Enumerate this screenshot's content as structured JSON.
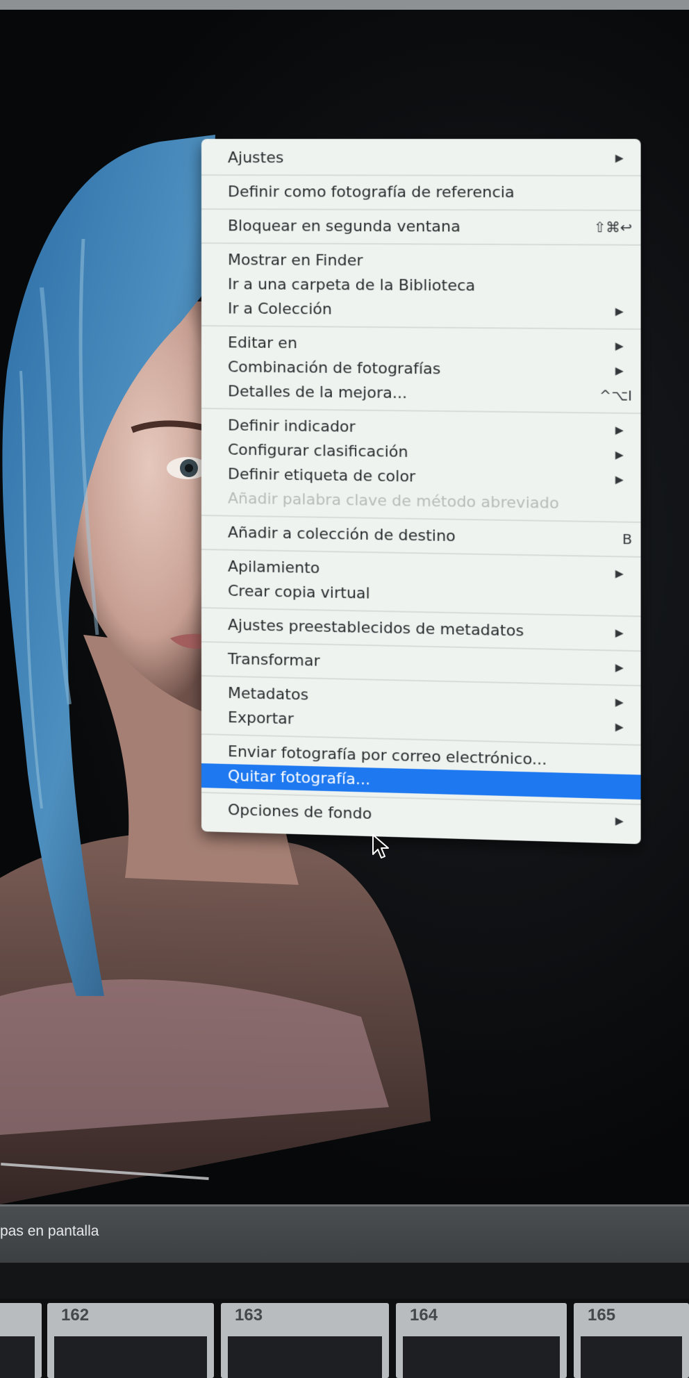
{
  "context_menu": {
    "groups": [
      {
        "items": [
          {
            "label": "Ajustes",
            "arrow": "▶"
          }
        ]
      },
      {
        "items": [
          {
            "label": "Definir como fotografía de referencia"
          }
        ]
      },
      {
        "items": [
          {
            "label": "Bloquear en segunda ventana",
            "shortcut": "⇧⌘↩"
          }
        ]
      },
      {
        "items": [
          {
            "label": "Mostrar en Finder"
          },
          {
            "label": "Ir a una carpeta de la Biblioteca"
          },
          {
            "label": "Ir a Colección",
            "arrow": "▶"
          }
        ]
      },
      {
        "items": [
          {
            "label": "Editar en",
            "arrow": "▶"
          },
          {
            "label": "Combinación de fotografías",
            "arrow": "▶"
          },
          {
            "label": "Detalles de la mejora...",
            "shortcut": "^⌥I"
          }
        ]
      },
      {
        "items": [
          {
            "label": "Definir indicador",
            "arrow": "▶"
          },
          {
            "label": "Configurar clasificación",
            "arrow": "▶"
          },
          {
            "label": "Definir etiqueta de color",
            "arrow": "▶"
          },
          {
            "label": "Añadir palabra clave de método abreviado",
            "disabled": true
          }
        ]
      },
      {
        "items": [
          {
            "label": "Añadir a colección de destino",
            "shortcut": "B"
          }
        ]
      },
      {
        "items": [
          {
            "label": "Apilamiento",
            "arrow": "▶"
          },
          {
            "label": "Crear copia virtual"
          }
        ]
      },
      {
        "items": [
          {
            "label": "Ajustes preestablecidos de metadatos",
            "arrow": "▶"
          }
        ]
      },
      {
        "items": [
          {
            "label": "Transformar",
            "arrow": "▶"
          }
        ]
      },
      {
        "items": [
          {
            "label": "Metadatos",
            "arrow": "▶"
          },
          {
            "label": "Exportar",
            "arrow": "▶"
          }
        ]
      },
      {
        "items": [
          {
            "label": "Enviar fotografía por correo electrónico..."
          },
          {
            "label": "Quitar fotografía...",
            "highlighted": true
          }
        ]
      },
      {
        "items": [
          {
            "label": "Opciones de fondo",
            "arrow": "▶"
          }
        ]
      }
    ]
  },
  "toolbar": {
    "label": "pas en pantalla"
  },
  "filmstrip": {
    "numbers": [
      "162",
      "163",
      "164",
      "165"
    ]
  },
  "colors": {
    "highlight": "#1e78f0",
    "menu_bg": "#eef3f0"
  }
}
